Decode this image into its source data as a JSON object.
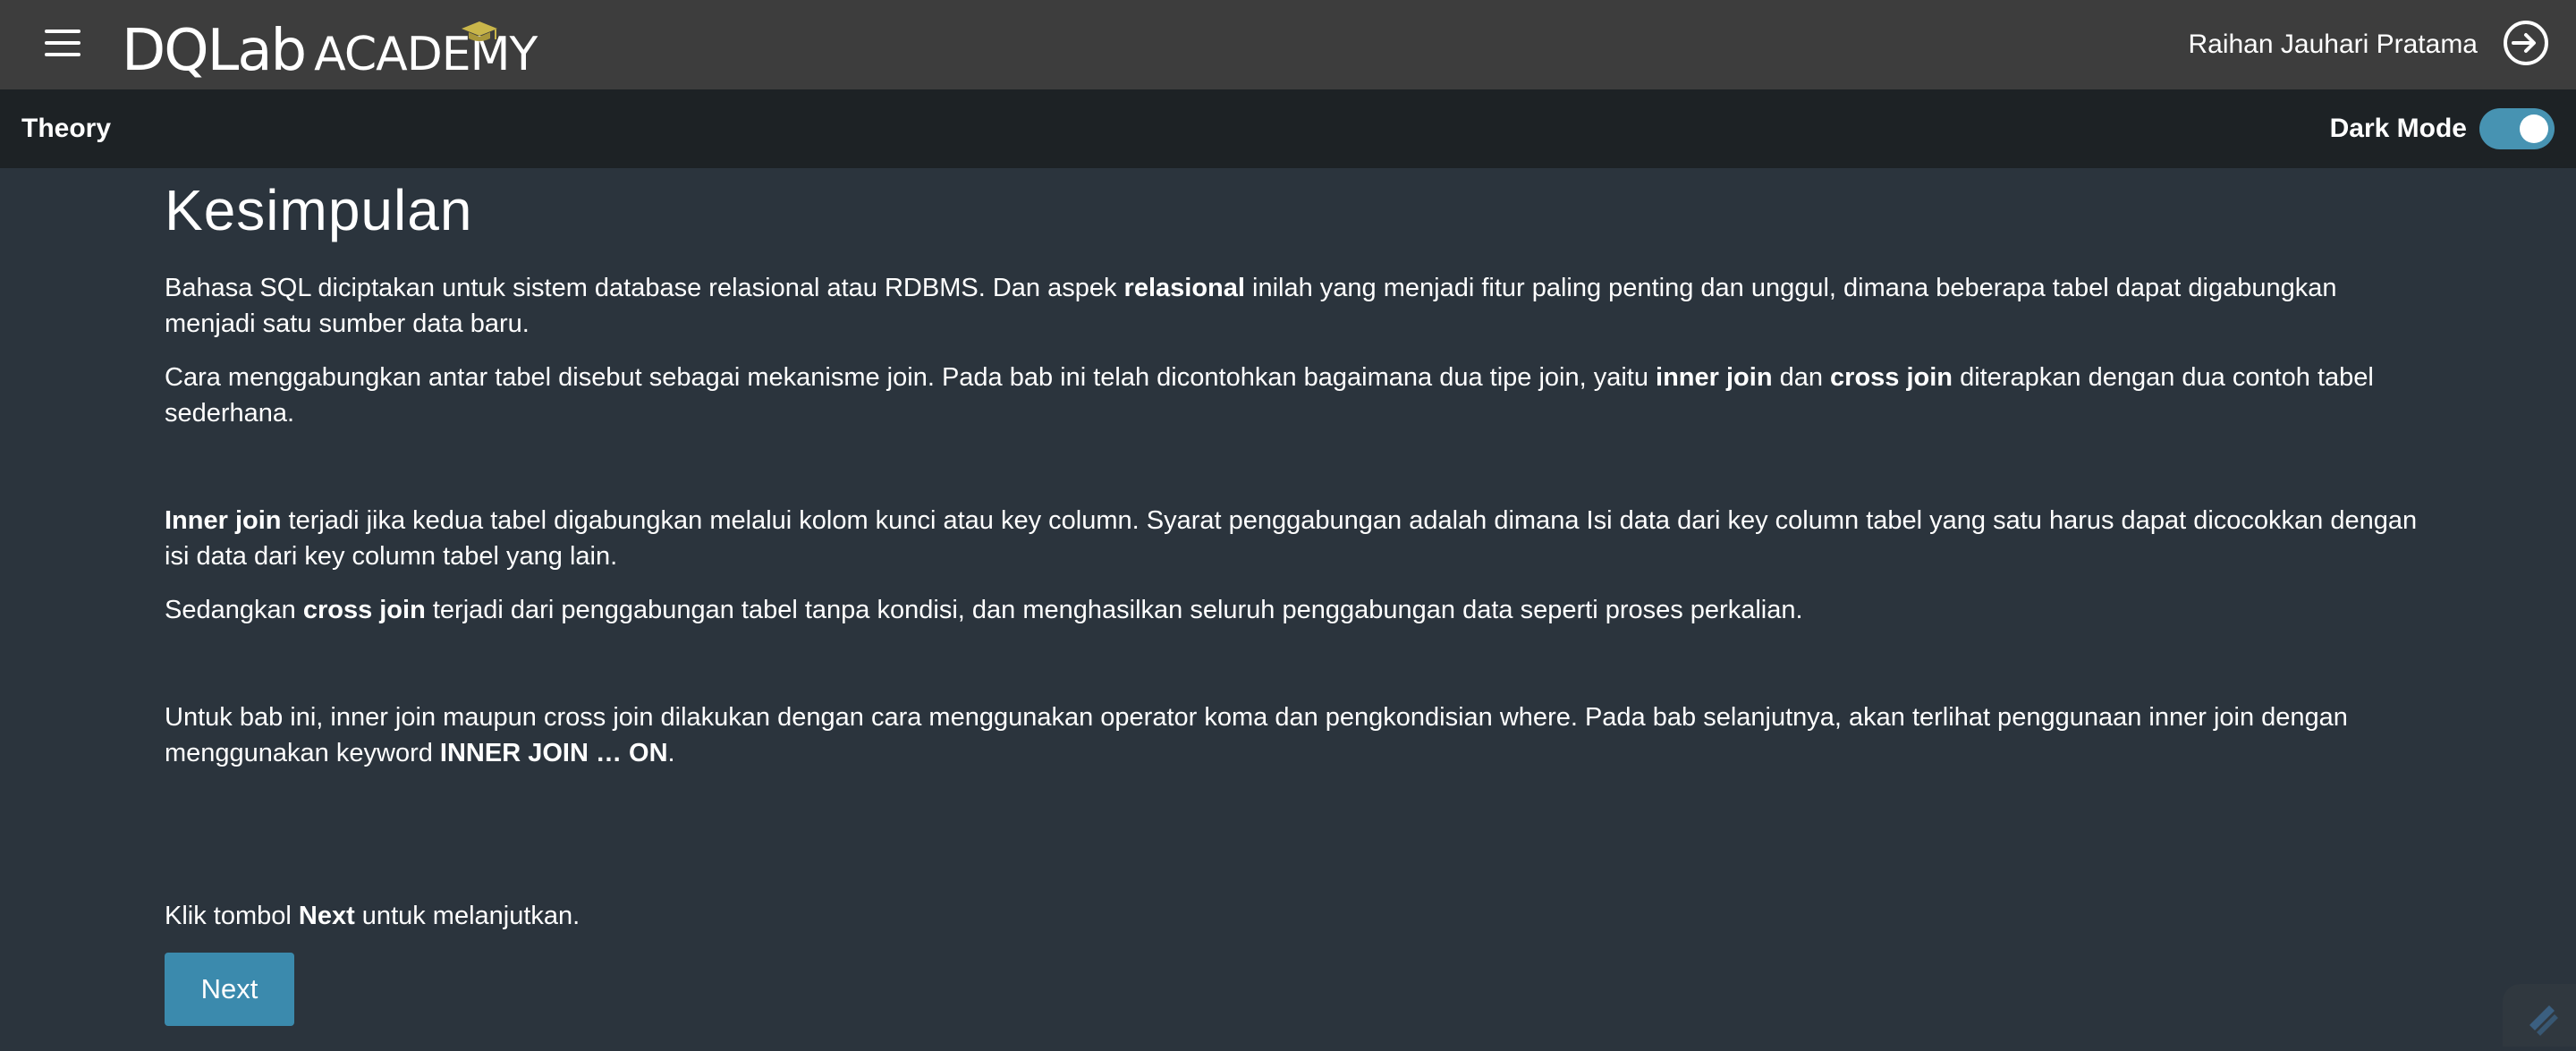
{
  "header": {
    "logo_main": "DQLab",
    "logo_sub": "ACADEMY",
    "user_name": "Raihan Jauhari Pratama"
  },
  "subheader": {
    "title": "Theory",
    "dark_mode_label": "Dark Mode",
    "dark_mode_on": true
  },
  "content": {
    "heading": "Kesimpulan",
    "p1": {
      "a": "Bahasa SQL diciptakan untuk sistem database relasional atau RDBMS. Dan aspek ",
      "b": "relasional",
      "c": " inilah yang menjadi fitur paling penting dan unggul, dimana beberapa tabel dapat digabungkan menjadi satu sumber data baru."
    },
    "p2": {
      "a": "Cara menggabungkan antar tabel disebut sebagai mekanisme join. Pada bab ini telah dicontohkan bagaimana dua tipe join, yaitu ",
      "b": "inner join",
      "c": " dan ",
      "d": "cross join",
      "e": " diterapkan dengan dua contoh tabel sederhana."
    },
    "p3": {
      "a": "Inner join",
      "b": " terjadi jika kedua tabel digabungkan melalui kolom kunci atau key column. Syarat penggabungan adalah dimana Isi data dari key column tabel yang satu harus dapat dicocokkan dengan isi data dari key column tabel yang lain."
    },
    "p4": {
      "a": "Sedangkan ",
      "b": "cross join",
      "c": " terjadi dari penggabungan tabel tanpa kondisi, dan menghasilkan seluruh penggabungan data seperti proses perkalian."
    },
    "p5": {
      "a": "Untuk bab ini, inner join maupun cross join dilakukan dengan cara menggunakan operator koma dan pengkondisian where. Pada bab selanjutnya, akan terlihat penggunaan inner join dengan menggunakan keyword ",
      "b": "INNER JOIN … ON",
      "c": "."
    },
    "p6": {
      "a": "Klik tombol ",
      "b": "Next",
      "c": " untuk melanjutkan."
    },
    "next_button": "Next"
  }
}
